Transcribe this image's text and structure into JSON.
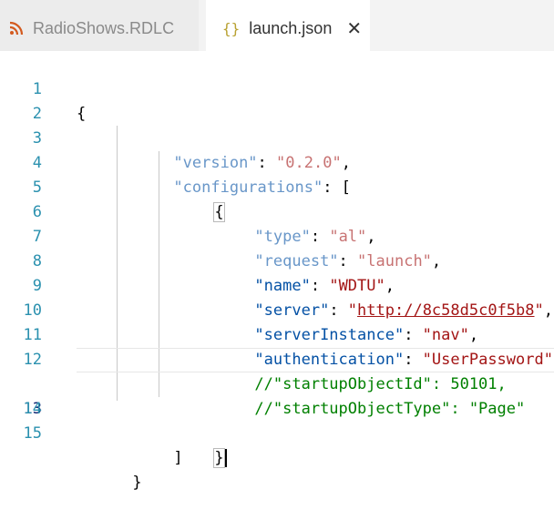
{
  "tabs": [
    {
      "label": "RadioShows.RDLC",
      "icon": "rss-icon",
      "active": false
    },
    {
      "label": "launch.json",
      "icon": "json-braces-icon",
      "active": true,
      "close": "✕"
    }
  ],
  "colors": {
    "line_number": "#2b91af",
    "key": "#0451a5",
    "string": "#a31515",
    "number": "#09885a",
    "comment": "#008000"
  },
  "editor": {
    "current_line": 13,
    "line_numbers": [
      "1",
      "2",
      "3",
      "4",
      "5",
      "6",
      "7",
      "8",
      "9",
      "10",
      "11",
      "12",
      "13",
      "14",
      "15"
    ],
    "code": {
      "l1_open": "{",
      "l2_key": "\"version\"",
      "l2_colon": ": ",
      "l2_val": "\"0.2.0\"",
      "l2_comma": ",",
      "l3_key": "\"configurations\"",
      "l3_rest": ": [",
      "l4_open": "{",
      "l5_key": "\"type\"",
      "l5_colon": ": ",
      "l5_val": "\"al\"",
      "l5_comma": ",",
      "l6_key": "\"request\"",
      "l6_colon": ": ",
      "l6_val": "\"launch\"",
      "l6_comma": ",",
      "l7_key": "\"name\"",
      "l7_colon": ": ",
      "l7_val": "\"WDTU\"",
      "l7_comma": ",",
      "l8_key": "\"server\"",
      "l8_colon": ": ",
      "l8_q1": "\"",
      "l8_url": "http://8c58d5c0f5b8",
      "l8_q2": "\"",
      "l8_comma": ",",
      "l9_key": "\"serverInstance\"",
      "l9_colon": ": ",
      "l9_val": "\"nav\"",
      "l9_comma": ",",
      "l10_key": "\"authentication\"",
      "l10_colon": ": ",
      "l10_val": "\"UserPassword\"",
      "l10_comma": ",",
      "l11_comment": "//\"startupObjectId\": 50101,",
      "l12_comment": "//\"startupObjectType\": \"Page\"",
      "l13_close": "}",
      "l14_close": "]",
      "l15_close": "}"
    }
  }
}
